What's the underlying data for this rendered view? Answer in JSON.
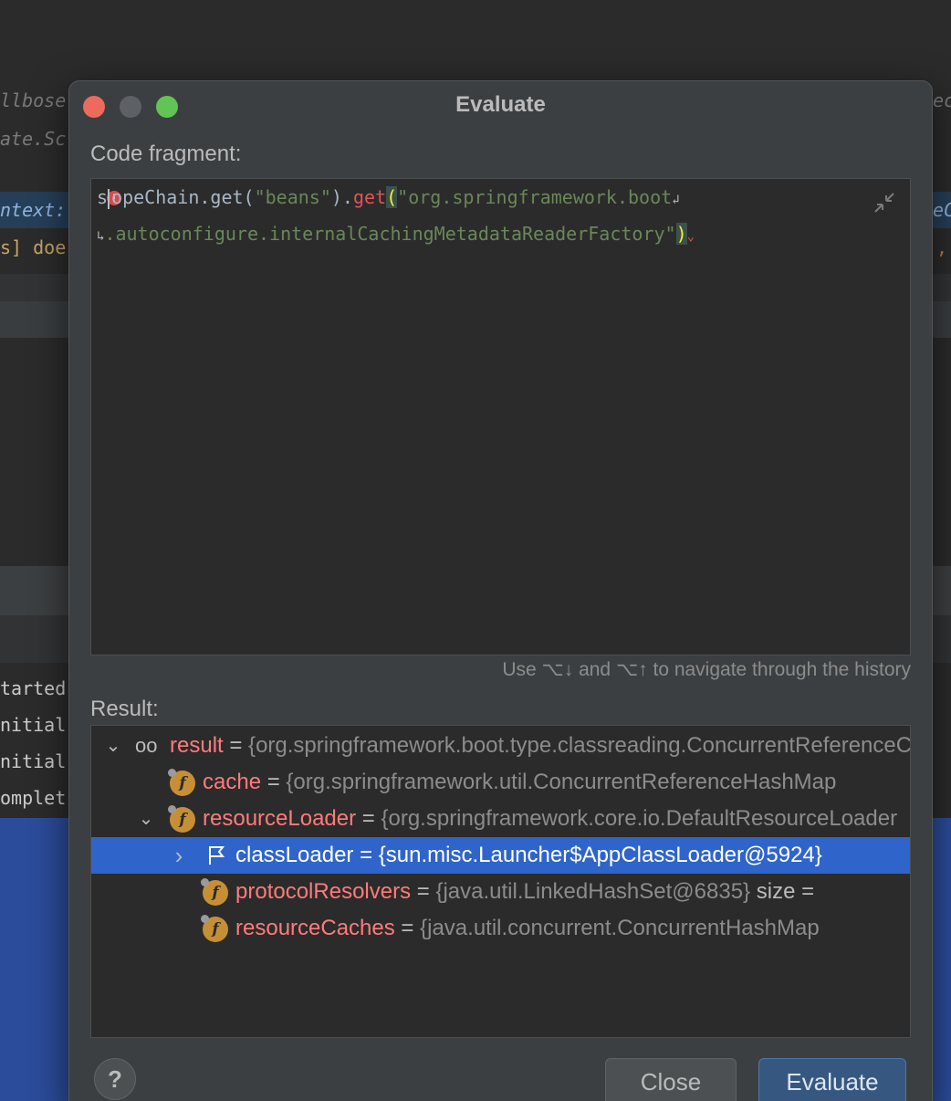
{
  "background": {
    "lines": [
      "llbose",
      "ate.Sc",
      "ntext:",
      "s] doe",
      "tarted",
      "nitial",
      "nitial",
      "omplet"
    ],
    "right_fragments": [
      "ec",
      "eC",
      ","
    ]
  },
  "dialog": {
    "title": "Evaluate",
    "code_label": "Code fragment:",
    "code": {
      "line1_pre": "s",
      "line1_plain": "opeChain.get(",
      "line1_str1": "\"beans\"",
      "line1_dot": ").",
      "line1_get": "get",
      "line1_paren": "(",
      "line1_str2": "\"org.springframework.boot",
      "wrap_mark": "↲",
      "line2_indent": "↳",
      "line2_str": ".autoconfigure.internalCachingMetadataReaderFactory\"",
      "line2_paren": ")",
      "error_badge": "!"
    },
    "history_hint": "Use ⌥↓ and ⌥↑ to navigate through the history",
    "result_label": "Result:",
    "tree": [
      {
        "name": "result",
        "eq": " = ",
        "value": "{org.springframework.boot.type.classreading.ConcurrentReferenceCachingMetadataReaderFactory"
      },
      {
        "name": "cache",
        "eq": " = ",
        "value": "{org.springframework.util.ConcurrentReferenceHashMap"
      },
      {
        "name": "resourceLoader",
        "eq": " = ",
        "value": "{org.springframework.core.io.DefaultResourceLoader"
      },
      {
        "name": "classLoader",
        "eq": " = ",
        "value": "{sun.misc.Launcher$AppClassLoader@5924}"
      },
      {
        "name": "protocolResolvers",
        "eq": " = ",
        "value": "{java.util.LinkedHashSet@6835}",
        "extra": "  size ="
      },
      {
        "name": "resourceCaches",
        "eq": " = ",
        "value": "{java.util.concurrent.ConcurrentHashMap"
      }
    ],
    "icons": {
      "chevron_down": "⌄",
      "chevron_right": "›",
      "field": "f",
      "watch": "oo"
    },
    "help_label": "?",
    "close_label": "Close",
    "evaluate_label": "Evaluate"
  },
  "colors": {
    "dialog_bg": "#3c3f41",
    "editor_bg": "#2b2b2b",
    "selection": "#2f65ca",
    "field_name": "#ff7b7b",
    "string": "#6a8759",
    "close_light": "#ed6a5e",
    "max_light": "#61c454"
  }
}
